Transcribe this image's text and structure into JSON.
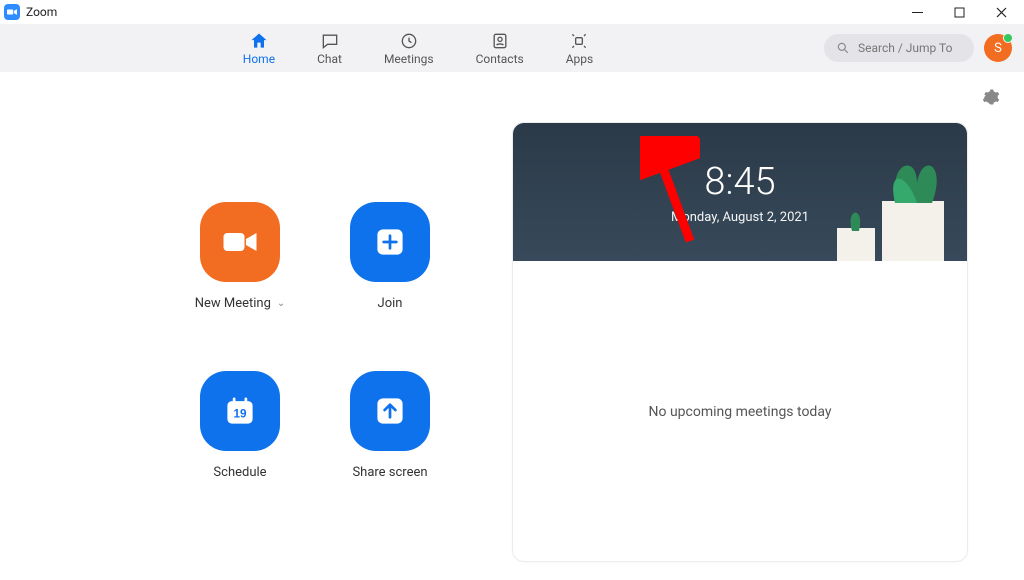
{
  "app": {
    "title": "Zoom"
  },
  "nav": {
    "tabs": [
      {
        "label": "Home",
        "active": true
      },
      {
        "label": "Chat",
        "active": false
      },
      {
        "label": "Meetings",
        "active": false
      },
      {
        "label": "Contacts",
        "active": false
      },
      {
        "label": "Apps",
        "active": false
      }
    ],
    "search_placeholder": "Search / Jump To",
    "avatar_initial": "S"
  },
  "actions": {
    "new_meeting": "New Meeting",
    "join": "Join",
    "schedule": "Schedule",
    "schedule_day": "19",
    "share": "Share screen"
  },
  "card": {
    "time": "8:45",
    "date": "Monday, August 2, 2021",
    "empty_msg": "No upcoming meetings today"
  },
  "colors": {
    "accent_blue": "#0E72ED",
    "accent_orange": "#F26D21"
  },
  "annotation": {
    "points_to": "apps-tab"
  }
}
